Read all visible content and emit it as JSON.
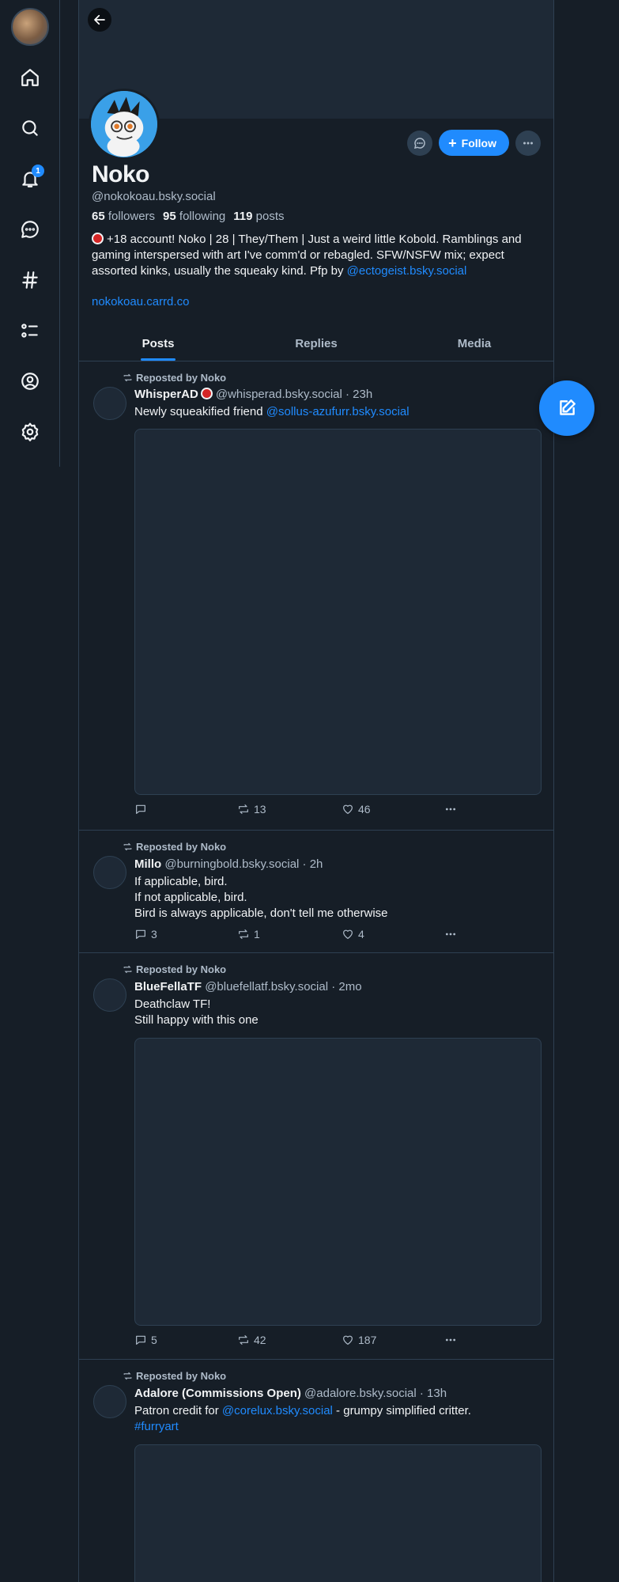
{
  "profile": {
    "display_name": "Noko",
    "handle": "@nokokoau.bsky.social",
    "followers_count": "65",
    "followers_label": "followers",
    "following_count": "95",
    "following_label": "following",
    "posts_count": "119",
    "posts_label": "posts",
    "bio_text": "+18 account! Noko | 28 | They/Them | Just a weird little Kobold. Ramblings and gaming interspersed with art I've comm'd or rebagled. SFW/NSFW mix; expect assorted kinks, usually the squeaky kind. Pfp by ",
    "bio_link": "@ectogeist.bsky.social",
    "website": "nokokoau.carrd.co",
    "follow_label": "Follow"
  },
  "nav": {
    "notification_count": "1",
    "icons": [
      "home-icon",
      "search-icon",
      "bell-icon",
      "chat-icon",
      "hashtag-icon",
      "list-icon",
      "profile-icon",
      "settings-icon"
    ]
  },
  "tabs": [
    "Posts",
    "Replies",
    "Media"
  ],
  "posts": [
    {
      "repost_label": "Reposted by Noko",
      "author": "WhisperAD",
      "adult_badge": true,
      "handle_time": "@whisperad.bsky.social · 23h",
      "text_prefix": "Newly squeakified friend ",
      "mention": "@sollus-azufurr.bsky.social",
      "replies": "",
      "reposts": "13",
      "likes": "46"
    },
    {
      "repost_label": "Reposted by Noko",
      "author": "Millo",
      "handle_time": "@burningbold.bsky.social · 2h",
      "lines": [
        "If applicable, bird.",
        "If not applicable, bird.",
        "Bird is always applicable, don't tell me otherwise"
      ],
      "replies": "3",
      "reposts": "1",
      "likes": "4"
    },
    {
      "repost_label": "Reposted by Noko",
      "author": "BlueFellaTF",
      "handle_time": "@bluefellatf.bsky.social · 2mo",
      "lines": [
        "Deathclaw TF!",
        "Still happy with this one"
      ],
      "replies": "5",
      "reposts": "42",
      "likes": "187"
    },
    {
      "repost_label": "Reposted by Noko",
      "author": "Adalore (Commissions Open)",
      "handle_time": "@adalore.bsky.social · 13h",
      "text_prefix": "Patron credit for ",
      "mention": "@corelux.bsky.social",
      "text_suffix": " - grumpy simplified critter.",
      "hashtag": "#furryart"
    }
  ],
  "colors": {
    "background": "#161e27",
    "accent": "#208bfe",
    "border": "#2e4052",
    "muted_text": "#aebbc9"
  }
}
